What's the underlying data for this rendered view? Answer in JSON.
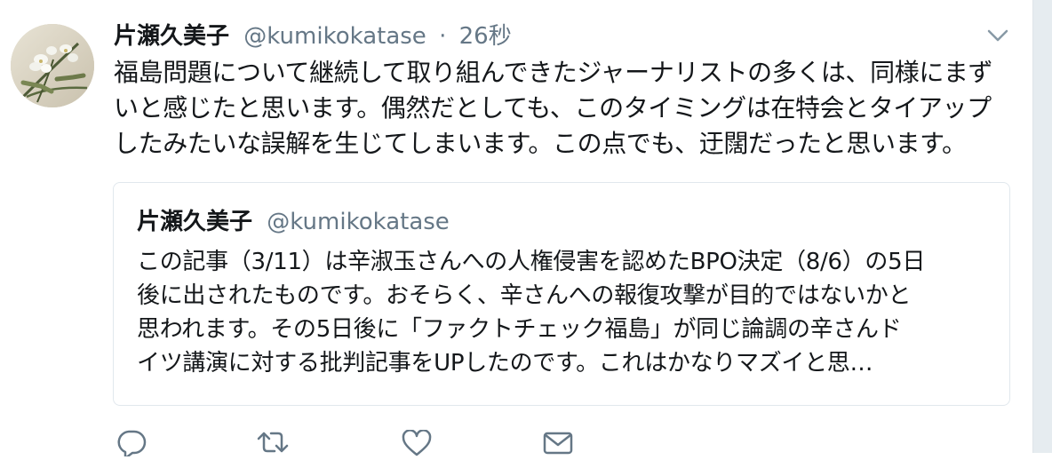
{
  "tweet": {
    "author_name": "片瀬久美子",
    "author_handle": "@kumikokatase",
    "separator": "·",
    "timestamp": "26秒",
    "text_lines": [
      "福島問題について継続して取り組んできたジャーナリストの多くは、同様にまず",
      "いと感じたと思います。偶然だとしても、このタイミングは在特会とタイアップ",
      "したみたいな誤解を生じてしまいます。この点でも、迂闊だったと思います。"
    ]
  },
  "quoted_tweet": {
    "author_name": "片瀬久美子",
    "author_handle": "@kumikokatase",
    "text_lines": [
      "この記事（3/11）は辛淑玉さんへの人権侵害を認めたBPO決定（8/6）の5日",
      "後に出されたものです。おそらく、辛さんへの報復攻撃が目的ではないかと",
      "思われます。その5日後に「ファクトチェック福島」が同じ論調の辛さんド",
      "イツ講演に対する批判記事をUPしたのです。これはかなりマズイと思…"
    ]
  },
  "icons": {
    "menu": "chevron-down-icon",
    "reply": "reply-icon",
    "retweet": "retweet-icon",
    "like": "heart-icon",
    "message": "envelope-icon",
    "avatar": "avatar"
  },
  "colors": {
    "text": "#14171a",
    "secondary": "#657786",
    "border": "#e1e8ed"
  }
}
